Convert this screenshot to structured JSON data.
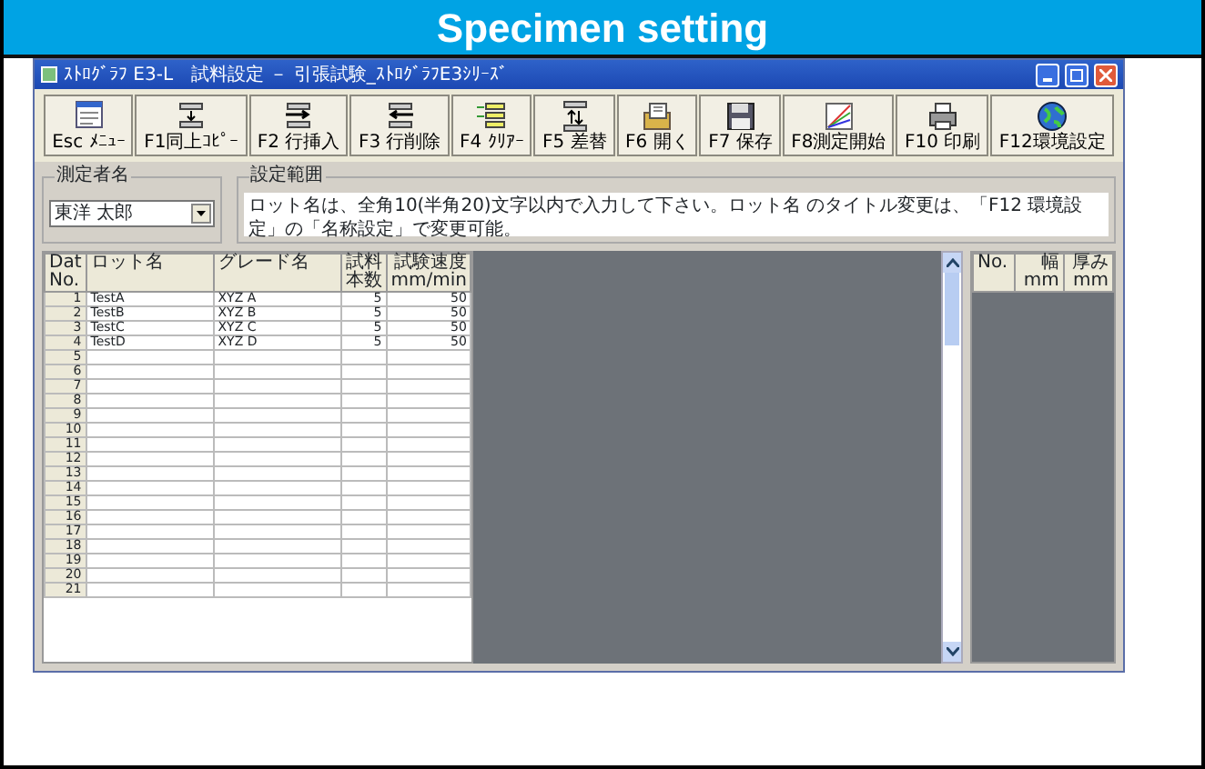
{
  "banner": {
    "title": "Specimen setting"
  },
  "window": {
    "title": "ｽﾄﾛｸﾞﾗﾌ E3-L　試料設定 － 引張試験_ｽﾄﾛｸﾞﾗﾌE3ｼﾘｰｽﾞ"
  },
  "toolbar": [
    {
      "label": "Esc ﾒﾆｭｰ"
    },
    {
      "label": "F1同上ｺﾋﾟｰ"
    },
    {
      "label": "F2 行挿入"
    },
    {
      "label": "F3 行削除"
    },
    {
      "label": "F4 ｸﾘｱｰ"
    },
    {
      "label": "F5 差替"
    },
    {
      "label": "F6 開く"
    },
    {
      "label": "F7 保存"
    },
    {
      "label": "F8測定開始"
    },
    {
      "label": "F10 印刷"
    },
    {
      "label": "F12環境設定"
    }
  ],
  "measurer": {
    "label": "測定者名",
    "value": "東洋 太郎"
  },
  "range": {
    "label": "設定範囲",
    "text": "ロット名は、全角10(半角20)文字以内で入力して下さい。ロット名 のタイトル変更は、「F12 環境設定」の「名称設定」で変更可能。"
  },
  "table": {
    "columns": [
      {
        "line1": "Dat",
        "line2": "No."
      },
      {
        "line1": "ロット名"
      },
      {
        "line1": "グレード名"
      },
      {
        "line1": "試料",
        "line2": "本数"
      },
      {
        "line1": "試験速度",
        "line2": "mm/min"
      }
    ],
    "rows": [
      [
        "1",
        "TestA",
        "XYZ A",
        "5",
        "50"
      ],
      [
        "2",
        "TestB",
        "XYZ B",
        "5",
        "50"
      ],
      [
        "3",
        "TestC",
        "XYZ C",
        "5",
        "50"
      ],
      [
        "4",
        "TestD",
        "XYZ D",
        "5",
        "50"
      ],
      [
        "5"
      ],
      [
        "6"
      ],
      [
        "7"
      ],
      [
        "8"
      ],
      [
        "9"
      ],
      [
        "10"
      ],
      [
        "11"
      ],
      [
        "12"
      ],
      [
        "13"
      ],
      [
        "14"
      ],
      [
        "15"
      ],
      [
        "16"
      ],
      [
        "17"
      ],
      [
        "18"
      ],
      [
        "19"
      ],
      [
        "20"
      ],
      [
        "21"
      ]
    ]
  },
  "side_table": {
    "columns": [
      {
        "line1": "No."
      },
      {
        "line1": "幅",
        "line2": "mm"
      },
      {
        "line1": "厚み",
        "line2": "mm"
      }
    ]
  }
}
